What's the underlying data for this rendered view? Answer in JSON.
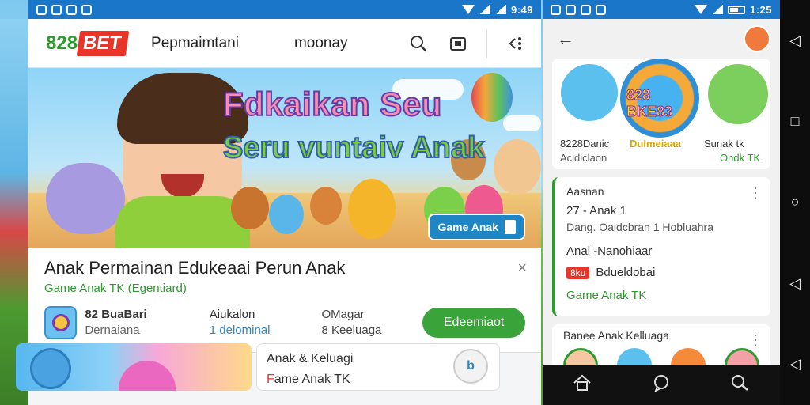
{
  "status_left": {
    "time": "9:49"
  },
  "status_right": {
    "time": "1:25"
  },
  "header": {
    "logo_num": "828",
    "logo_bet": "BET",
    "title": "Pepmaimtani",
    "money": "moonay"
  },
  "banner": {
    "title": "Fdkaikan Seu",
    "subtitle": "Seru vuntaiv Anak",
    "badge": "Game Anak"
  },
  "app": {
    "title": "Anak Permainan Edukeaai Perun Anak",
    "category": "Game Anak TK (Egentiard)",
    "col1_a": "82 BuaBari",
    "col1_b": "Dernaiana",
    "col2_a": "Aiukalon",
    "col2_b": "1 delominal",
    "col3_a": "OMagar",
    "col3_b": "8 Keeluaga",
    "install": "Edeemiaot",
    "close": "×"
  },
  "bottom": {
    "card_t1": "Anak & Keluagi",
    "card_t2_a": "F",
    "card_t2_b": "ame Anak TK",
    "avatar": "b"
  },
  "right": {
    "back": "←",
    "card1": {
      "logo": "828 BKE83",
      "l1": "8228Danic",
      "l1b": "Acldiclaon",
      "l2": "Dulmeiaaa",
      "l3": "Sunak tk",
      "l3b": "Ondk TK"
    },
    "card2": {
      "title": "Aasnan",
      "row": "27 - Anak 1",
      "row2": "Dang. Oaidcbran 1 Hobluahra",
      "sub": "Anal -Nanohiaar",
      "tag": "8ku",
      "sub2": "Bdueldobai",
      "green": "Game Anak TK"
    },
    "card3": {
      "title": "Banee Anak Kelluaga"
    }
  },
  "colors": {
    "accent": "#2e9a2e",
    "brand_red": "#e8352a",
    "status_blue": "#1976c8"
  }
}
